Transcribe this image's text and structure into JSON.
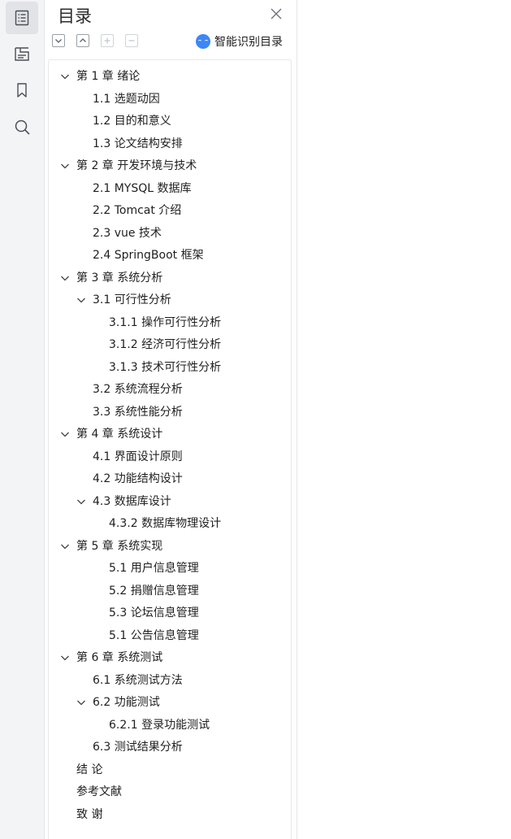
{
  "panel": {
    "title": "目录",
    "smart_toc_label": "智能识别目录",
    "icons": {
      "rail": [
        "toc-icon",
        "thumbnail-icon",
        "bookmark-icon",
        "search-icon"
      ],
      "close": "close-icon",
      "tools": [
        "collapse-all-icon",
        "expand-all-icon",
        "add-entry-icon",
        "remove-entry-icon"
      ]
    }
  },
  "toc": [
    {
      "label": "第 1 章  绪论",
      "level": 0,
      "expanded": true
    },
    {
      "label": "1.1 选题动因",
      "level": 1,
      "expanded": null
    },
    {
      "label": "1.2 目的和意义",
      "level": 1,
      "expanded": null
    },
    {
      "label": "1.3 论文结构安排",
      "level": 1,
      "expanded": null
    },
    {
      "label": "第 2 章  开发环境与技术",
      "level": 0,
      "expanded": true
    },
    {
      "label": "2.1 MYSQL 数据库",
      "level": 1,
      "expanded": null
    },
    {
      "label": "2.2 Tomcat  介绍",
      "level": 1,
      "expanded": null
    },
    {
      "label": "2.3 vue 技术",
      "level": 1,
      "expanded": null
    },
    {
      "label": "2.4 SpringBoot 框架",
      "level": 1,
      "expanded": null
    },
    {
      "label": "第 3 章  系统分析",
      "level": 0,
      "expanded": true
    },
    {
      "label": "3.1 可行性分析",
      "level": 1,
      "expanded": true
    },
    {
      "label": "3.1.1 操作可行性分析",
      "level": 2,
      "expanded": null
    },
    {
      "label": "3.1.2 经济可行性分析",
      "level": 2,
      "expanded": null
    },
    {
      "label": "3.1.3 技术可行性分析",
      "level": 2,
      "expanded": null
    },
    {
      "label": "3.2 系统流程分析",
      "level": 1,
      "expanded": null
    },
    {
      "label": "3.3 系统性能分析",
      "level": 1,
      "expanded": null
    },
    {
      "label": "第 4 章  系统设计",
      "level": 0,
      "expanded": true
    },
    {
      "label": "4.1 界面设计原则",
      "level": 1,
      "expanded": null
    },
    {
      "label": "4.2 功能结构设计",
      "level": 1,
      "expanded": null
    },
    {
      "label": "4.3 数据库设计",
      "level": 1,
      "expanded": true
    },
    {
      "label": "4.3.2  数据库物理设计",
      "level": 2,
      "expanded": null
    },
    {
      "label": "第 5 章  系统实现",
      "level": 0,
      "expanded": true
    },
    {
      "label": "5.1 用户信息管理",
      "level": 2,
      "expanded": null
    },
    {
      "label": "5.2  捐赠信息管理",
      "level": 2,
      "expanded": null
    },
    {
      "label": "5.3 论坛信息管理",
      "level": 2,
      "expanded": null
    },
    {
      "label": "5.1 公告信息管理",
      "level": 2,
      "expanded": null
    },
    {
      "label": "第 6 章  系统测试",
      "level": 0,
      "expanded": true
    },
    {
      "label": "6.1  系统测试方法",
      "level": 1,
      "expanded": null
    },
    {
      "label": "6.2  功能测试",
      "level": 1,
      "expanded": true
    },
    {
      "label": "6.2.1  登录功能测试",
      "level": 2,
      "expanded": null
    },
    {
      "label": "6.3  测试结果分析",
      "level": 1,
      "expanded": null
    },
    {
      "label": "结    论",
      "level": 0,
      "expanded": null
    },
    {
      "label": "参考文献",
      "level": 0,
      "expanded": null
    },
    {
      "label": "致    谢",
      "level": 0,
      "expanded": null
    }
  ]
}
